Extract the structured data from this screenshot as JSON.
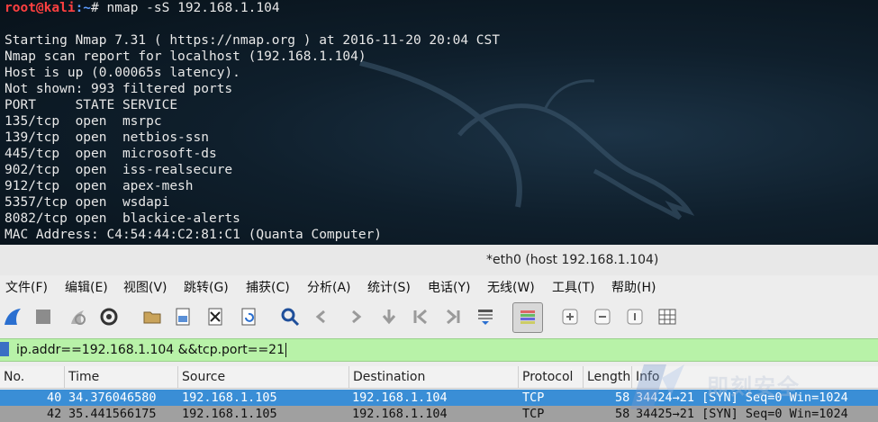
{
  "terminal": {
    "prompt_user": "root@kali",
    "prompt_path": ":~",
    "prompt_symbol": "# ",
    "command": "nmap -sS 192.168.1.104",
    "lines": [
      "Starting Nmap 7.31 ( https://nmap.org ) at 2016-11-20 20:04 CST",
      "Nmap scan report for localhost (192.168.1.104)",
      "Host is up (0.00065s latency).",
      "Not shown: 993 filtered ports",
      "PORT     STATE SERVICE",
      "135/tcp  open  msrpc",
      "139/tcp  open  netbios-ssn",
      "445/tcp  open  microsoft-ds",
      "902/tcp  open  iss-realsecure",
      "912/tcp  open  apex-mesh",
      "5357/tcp open  wsdapi",
      "8082/tcp open  blackice-alerts",
      "MAC Address: C4:54:44:C2:81:C1 (Quanta Computer)"
    ]
  },
  "wireshark": {
    "title": "*eth0 (host 192.168.1.104)",
    "menu": [
      "文件(F)",
      "编辑(E)",
      "视图(V)",
      "跳转(G)",
      "捕获(C)",
      "分析(A)",
      "统计(S)",
      "电话(Y)",
      "无线(W)",
      "工具(T)",
      "帮助(H)"
    ],
    "toolbar_icons": [
      "shark-fin-start-icon",
      "stop-capture-icon",
      "restart-capture-icon",
      "capture-options-icon",
      "open-file-icon",
      "save-file-icon",
      "close-file-icon",
      "reload-file-icon",
      "find-packet-icon",
      "go-back-icon",
      "go-forward-icon",
      "go-to-packet-icon",
      "first-packet-icon",
      "last-packet-icon",
      "auto-scroll-icon",
      "colorize-icon",
      "zoom-in-icon",
      "zoom-out-icon",
      "normal-size-icon",
      "resize-columns-icon"
    ],
    "filter": "ip.addr==192.168.1.104 &&tcp.port==21",
    "columns": [
      "No.",
      "Time",
      "Source",
      "Destination",
      "Protocol",
      "Length",
      "Info"
    ],
    "rows": [
      {
        "no": "40",
        "time": "34.376046580",
        "source": "192.168.1.105",
        "destination": "192.168.1.104",
        "protocol": "TCP",
        "length": "58",
        "info": "34424→21 [SYN] Seq=0 Win=1024"
      },
      {
        "no": "42",
        "time": "35.441566175",
        "source": "192.168.1.105",
        "destination": "192.168.1.104",
        "protocol": "TCP",
        "length": "58",
        "info": "34425→21 [SYN] Seq=0 Win=1024"
      }
    ],
    "selected_row_color": "#3a8ed6",
    "filter_bg_color": "#b8f2a8"
  },
  "watermark": {
    "text": "即刻安全"
  }
}
